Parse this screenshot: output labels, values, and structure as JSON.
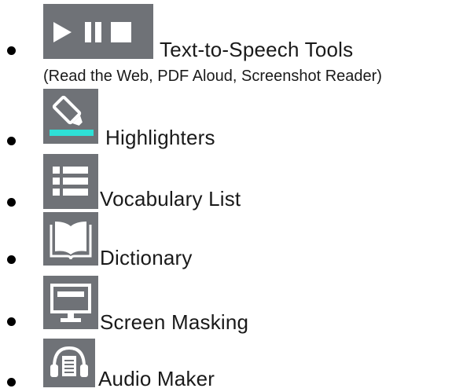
{
  "tools": [
    {
      "label": "Text-to-Speech Tools",
      "sublabel": "(Read the Web, PDF Aloud, Screenshot Reader)",
      "icon": "play-pause-stop-icon"
    },
    {
      "label": "Highlighters",
      "icon": "highlighter-icon"
    },
    {
      "label": "Vocabulary List",
      "icon": "list-icon"
    },
    {
      "label": "Dictionary",
      "icon": "book-icon"
    },
    {
      "label": "Screen Masking",
      "icon": "monitor-icon"
    },
    {
      "label": "Audio Maker",
      "icon": "headphones-icon"
    }
  ],
  "colors": {
    "icon_bg": "#6f7277",
    "highlight_accent": "#2ee0d6",
    "icon_fg": "#ffffff"
  }
}
